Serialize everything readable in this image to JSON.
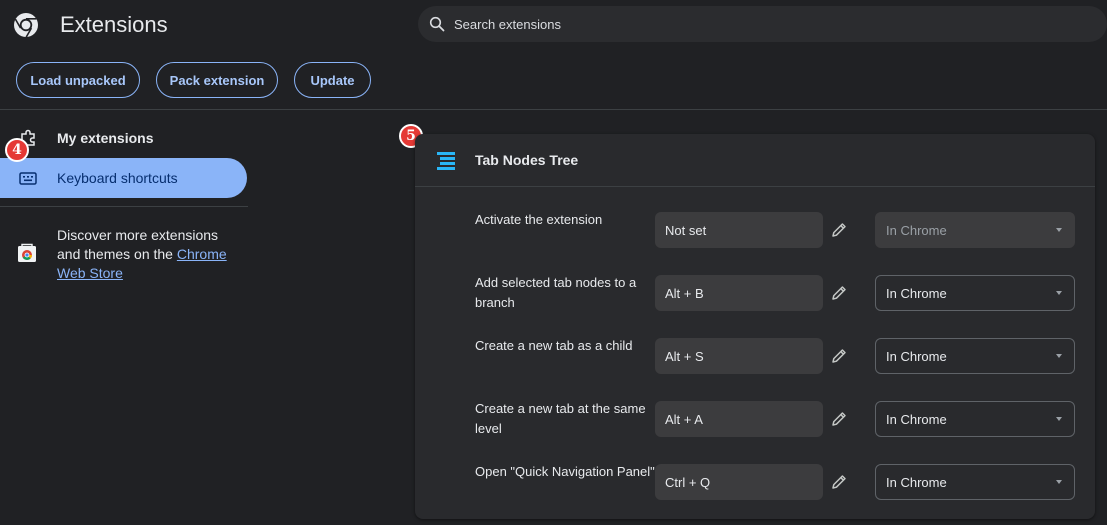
{
  "header": {
    "title": "Extensions",
    "search_placeholder": "Search extensions"
  },
  "toolbar": {
    "load_unpacked": "Load unpacked",
    "pack_extension": "Pack extension",
    "update": "Update"
  },
  "sidebar": {
    "items": [
      {
        "label": "My extensions",
        "icon": "puzzle-icon"
      },
      {
        "label": "Keyboard shortcuts",
        "icon": "keyboard-icon",
        "selected": true
      }
    ],
    "discover_text": "Discover more extensions and themes on the",
    "store_link": "Chrome Web Store"
  },
  "badges": {
    "sidebar": "4",
    "card": "5"
  },
  "extension": {
    "name": "Tab Nodes Tree",
    "shortcuts": [
      {
        "label": "Activate the extension",
        "key": "Not set",
        "scope": "In Chrome",
        "disabled": true
      },
      {
        "label": "Add selected tab nodes to a branch",
        "key": "Alt + B",
        "scope": "In Chrome",
        "disabled": false
      },
      {
        "label": "Create a new tab as a child",
        "key": "Alt + S",
        "scope": "In Chrome",
        "disabled": false
      },
      {
        "label": "Create a new tab at the same level",
        "key": "Alt + A",
        "scope": "In Chrome",
        "disabled": false
      },
      {
        "label": "Open \"Quick Navigation Panel\"",
        "key": "Ctrl + Q",
        "scope": "In Chrome",
        "disabled": false
      }
    ]
  },
  "colors": {
    "background": "#202124",
    "card": "#292a2d",
    "accent": "#8ab4f8",
    "badge": "#e53935"
  }
}
